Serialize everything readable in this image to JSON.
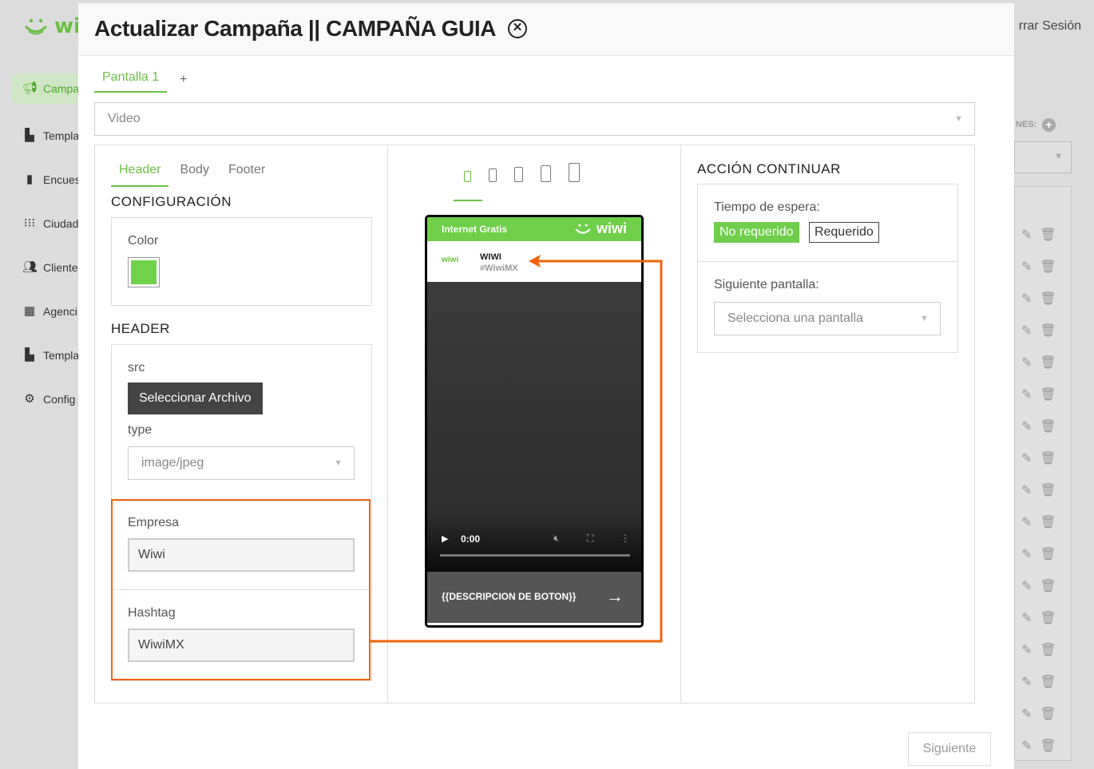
{
  "app": {
    "logo_text": "wi",
    "logout_label": "rrar Sesión",
    "sidebar": [
      {
        "label": "Campa",
        "icon": "megaphone-icon"
      },
      {
        "label": "Templa",
        "icon": "layout-icon"
      },
      {
        "label": "Encues",
        "icon": "clipboard-icon"
      },
      {
        "label": "Ciudad",
        "icon": "grid-dots-icon"
      },
      {
        "label": "Cliente",
        "icon": "users-icon"
      },
      {
        "label": "Agenci",
        "icon": "building-icon"
      },
      {
        "label": "Templa",
        "icon": "layout-icon"
      },
      {
        "label": "Config",
        "icon": "gear-icon"
      }
    ],
    "right_panel_label": "NES:"
  },
  "modal": {
    "title": "Actualizar Campaña || CAMPAÑA GUIA",
    "screen_tab": "Pantalla 1",
    "add_screen": "+",
    "type_select": "Video",
    "sub_tabs": [
      "Header",
      "Body",
      "Footer"
    ],
    "config_title": "CONFIGURACIÓN",
    "color_label": "Color",
    "color_value": "#6fd24a",
    "header_title": "HEADER",
    "src_label": "src",
    "select_file_button": "Seleccionar Archivo",
    "type_label": "type",
    "type_value": "image/jpeg",
    "empresa_label": "Empresa",
    "empresa_value": "Wiwi",
    "hashtag_label": "Hashtag",
    "hashtag_value": "WiwiMX",
    "next_button": "Siguiente"
  },
  "preview": {
    "top_text": "Internet Gratis",
    "brand": "wiwi",
    "company": "WIWI",
    "hashtag": "#WiwiMX",
    "mini_logo": "wiwi",
    "video_time": "0:00",
    "button_text": "{{DESCRIPCION DE BOTON}}"
  },
  "action": {
    "title": "ACCIÓN CONTINUAR",
    "wait_label": "Tiempo de espera:",
    "not_required": "No requerido",
    "required": "Requerido",
    "next_screen_label": "Siguiente pantalla:",
    "next_screen_placeholder": "Selecciona una pantalla"
  },
  "colors": {
    "accent": "#6cbf45",
    "highlight": "#f0640a"
  }
}
